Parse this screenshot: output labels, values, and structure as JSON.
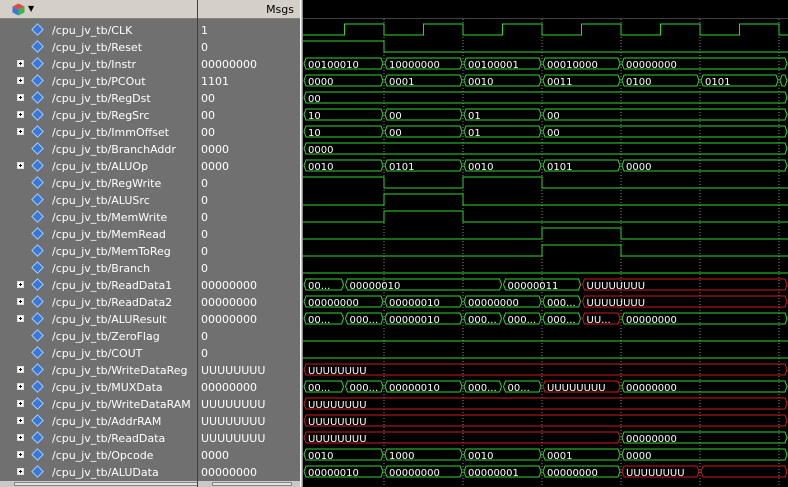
{
  "header": {
    "values_title": "Msgs"
  },
  "colors": {
    "wave": "#2fd82f",
    "undef": "#d01818",
    "cursor": "#d01818",
    "text": "#ffffff",
    "grid": "#8a8a8a"
  },
  "clock": {
    "name": "/cpu_jv_tb/CLK",
    "value": "1"
  },
  "signals": [
    {
      "name": "/cpu_jv_tb/CLK",
      "value": "1",
      "bus": false,
      "kind": "clock"
    },
    {
      "name": "/cpu_jv_tb/Reset",
      "value": "0",
      "bus": false,
      "kind": "bit",
      "levels": [
        1,
        0,
        0,
        0,
        0,
        0,
        0
      ]
    },
    {
      "name": "/cpu_jv_tb/Instr",
      "value": "00000000",
      "bus": true,
      "segs": [
        [
          "00100010",
          0,
          1
        ],
        [
          "10000000",
          1,
          2
        ],
        [
          "00100001",
          2,
          3
        ],
        [
          "00010000",
          3,
          4
        ],
        [
          "00000000",
          4,
          7
        ]
      ]
    },
    {
      "name": "/cpu_jv_tb/PCOut",
      "value": "1101",
      "bus": true,
      "segs": [
        [
          "0000",
          0,
          1
        ],
        [
          "0001",
          1,
          2
        ],
        [
          "0010",
          2,
          3
        ],
        [
          "0011",
          3,
          4
        ],
        [
          "0100",
          4,
          5
        ],
        [
          "0101",
          5,
          6
        ],
        [
          "",
          6,
          7
        ]
      ]
    },
    {
      "name": "/cpu_jv_tb/RegDst",
      "value": "00",
      "bus": true,
      "segs": [
        [
          "00",
          0,
          7
        ]
      ]
    },
    {
      "name": "/cpu_jv_tb/RegSrc",
      "value": "00",
      "bus": true,
      "segs": [
        [
          "10",
          0,
          1
        ],
        [
          "00",
          1,
          2
        ],
        [
          "01",
          2,
          3
        ],
        [
          "00",
          3,
          7
        ]
      ]
    },
    {
      "name": "/cpu_jv_tb/ImmOffset",
      "value": "00",
      "bus": true,
      "segs": [
        [
          "10",
          0,
          1
        ],
        [
          "00",
          1,
          2
        ],
        [
          "01",
          2,
          3
        ],
        [
          "00",
          3,
          7
        ]
      ]
    },
    {
      "name": "/cpu_jv_tb/BranchAddr",
      "value": "0000",
      "bus": false,
      "segs": [
        [
          "0000",
          0,
          7
        ]
      ]
    },
    {
      "name": "/cpu_jv_tb/ALUOp",
      "value": "0000",
      "bus": true,
      "segs": [
        [
          "0010",
          0,
          1
        ],
        [
          "0101",
          1,
          2
        ],
        [
          "0010",
          2,
          3
        ],
        [
          "0101",
          3,
          4
        ],
        [
          "0000",
          4,
          7
        ]
      ]
    },
    {
      "name": "/cpu_jv_tb/RegWrite",
      "value": "0",
      "bus": false,
      "kind": "bit",
      "levels": [
        1,
        0,
        1,
        0,
        0,
        0,
        0
      ]
    },
    {
      "name": "/cpu_jv_tb/ALUSrc",
      "value": "0",
      "bus": false,
      "kind": "bit",
      "levels": [
        0,
        1,
        0,
        0,
        0,
        0,
        0
      ]
    },
    {
      "name": "/cpu_jv_tb/MemWrite",
      "value": "0",
      "bus": false,
      "kind": "bit",
      "levels": [
        0,
        1,
        0,
        0,
        0,
        0,
        0
      ]
    },
    {
      "name": "/cpu_jv_tb/MemRead",
      "value": "0",
      "bus": false,
      "kind": "bit",
      "levels": [
        0,
        0,
        0,
        1,
        0,
        0,
        0
      ]
    },
    {
      "name": "/cpu_jv_tb/MemToReg",
      "value": "0",
      "bus": false,
      "kind": "bit",
      "levels": [
        0,
        0,
        0,
        1,
        0,
        0,
        0
      ]
    },
    {
      "name": "/cpu_jv_tb/Branch",
      "value": "0",
      "bus": false,
      "kind": "bit",
      "levels": [
        0,
        0,
        0,
        0,
        0,
        0,
        0
      ]
    },
    {
      "name": "/cpu_jv_tb/ReadData1",
      "value": "00000000",
      "bus": true,
      "segs": [
        [
          "00...",
          0,
          0.5
        ],
        [
          "00000010",
          0.5,
          2.5
        ],
        [
          "00000011",
          2.5,
          3.5
        ],
        [
          "UUUUUUUU",
          3.5,
          7,
          "u"
        ]
      ]
    },
    {
      "name": "/cpu_jv_tb/ReadData2",
      "value": "00000000",
      "bus": true,
      "segs": [
        [
          "00000000",
          0,
          1
        ],
        [
          "00000010",
          1,
          2
        ],
        [
          "00000000",
          2,
          3
        ],
        [
          "000...",
          3,
          3.5
        ],
        [
          "UUUUUUUU",
          3.5,
          7,
          "u"
        ]
      ]
    },
    {
      "name": "/cpu_jv_tb/ALUResult",
      "value": "00000000",
      "bus": true,
      "segs": [
        [
          "00...",
          0,
          0.5
        ],
        [
          "000...",
          0.5,
          1
        ],
        [
          "00000010",
          1,
          2
        ],
        [
          "000...",
          2,
          2.5
        ],
        [
          "000...",
          2.5,
          3
        ],
        [
          "000...",
          3,
          3.5
        ],
        [
          "UU...",
          3.5,
          4,
          "u"
        ],
        [
          "00000000",
          4,
          7
        ]
      ]
    },
    {
      "name": "/cpu_jv_tb/ZeroFlag",
      "value": "0",
      "bus": false,
      "kind": "bit",
      "levels": [
        0,
        0,
        0,
        0,
        0,
        0,
        0
      ]
    },
    {
      "name": "/cpu_jv_tb/COUT",
      "value": "0",
      "bus": false,
      "kind": "bit",
      "levels": [
        0,
        0,
        0,
        0,
        0,
        0,
        0
      ]
    },
    {
      "name": "/cpu_jv_tb/WriteDataReg",
      "value": "UUUUUUUU",
      "bus": true,
      "segs": [
        [
          "UUUUUUUU",
          0,
          7,
          "u"
        ]
      ]
    },
    {
      "name": "/cpu_jv_tb/MUXData",
      "value": "00000000",
      "bus": true,
      "segs": [
        [
          "00...",
          0,
          0.5
        ],
        [
          "000...",
          0.5,
          1
        ],
        [
          "00000010",
          1,
          2
        ],
        [
          "000...",
          2,
          2.5
        ],
        [
          "00...",
          2.5,
          3
        ],
        [
          "UUUUUUUU",
          3,
          4,
          "u"
        ],
        [
          "00000000",
          4,
          7
        ]
      ]
    },
    {
      "name": "/cpu_jv_tb/WriteDataRAM",
      "value": "UUUUUUUU",
      "bus": true,
      "segs": [
        [
          "UUUUUUUU",
          0,
          7,
          "u"
        ]
      ]
    },
    {
      "name": "/cpu_jv_tb/AddrRAM",
      "value": "UUUUUUUU",
      "bus": true,
      "segs": [
        [
          "UUUUUUUU",
          0,
          7,
          "u"
        ]
      ]
    },
    {
      "name": "/cpu_jv_tb/ReadData",
      "value": "UUUUUUUU",
      "bus": true,
      "segs": [
        [
          "UUUUUUUU",
          0,
          4,
          "u"
        ],
        [
          "00000000",
          4,
          7
        ]
      ]
    },
    {
      "name": "/cpu_jv_tb/Opcode",
      "value": "0000",
      "bus": true,
      "segs": [
        [
          "0010",
          0,
          1
        ],
        [
          "1000",
          1,
          2
        ],
        [
          "0010",
          2,
          3
        ],
        [
          "0001",
          3,
          4
        ],
        [
          "0000",
          4,
          7
        ]
      ]
    },
    {
      "name": "/cpu_jv_tb/ALUData",
      "value": "00000000",
      "bus": true,
      "segs": [
        [
          "00000010",
          0,
          1
        ],
        [
          "00000000",
          1,
          2
        ],
        [
          "00000001",
          2,
          3
        ],
        [
          "00000000",
          3,
          4
        ],
        [
          "UUUUUUUU",
          4,
          5,
          "u"
        ],
        [
          "",
          5,
          7,
          "u"
        ]
      ]
    }
  ]
}
